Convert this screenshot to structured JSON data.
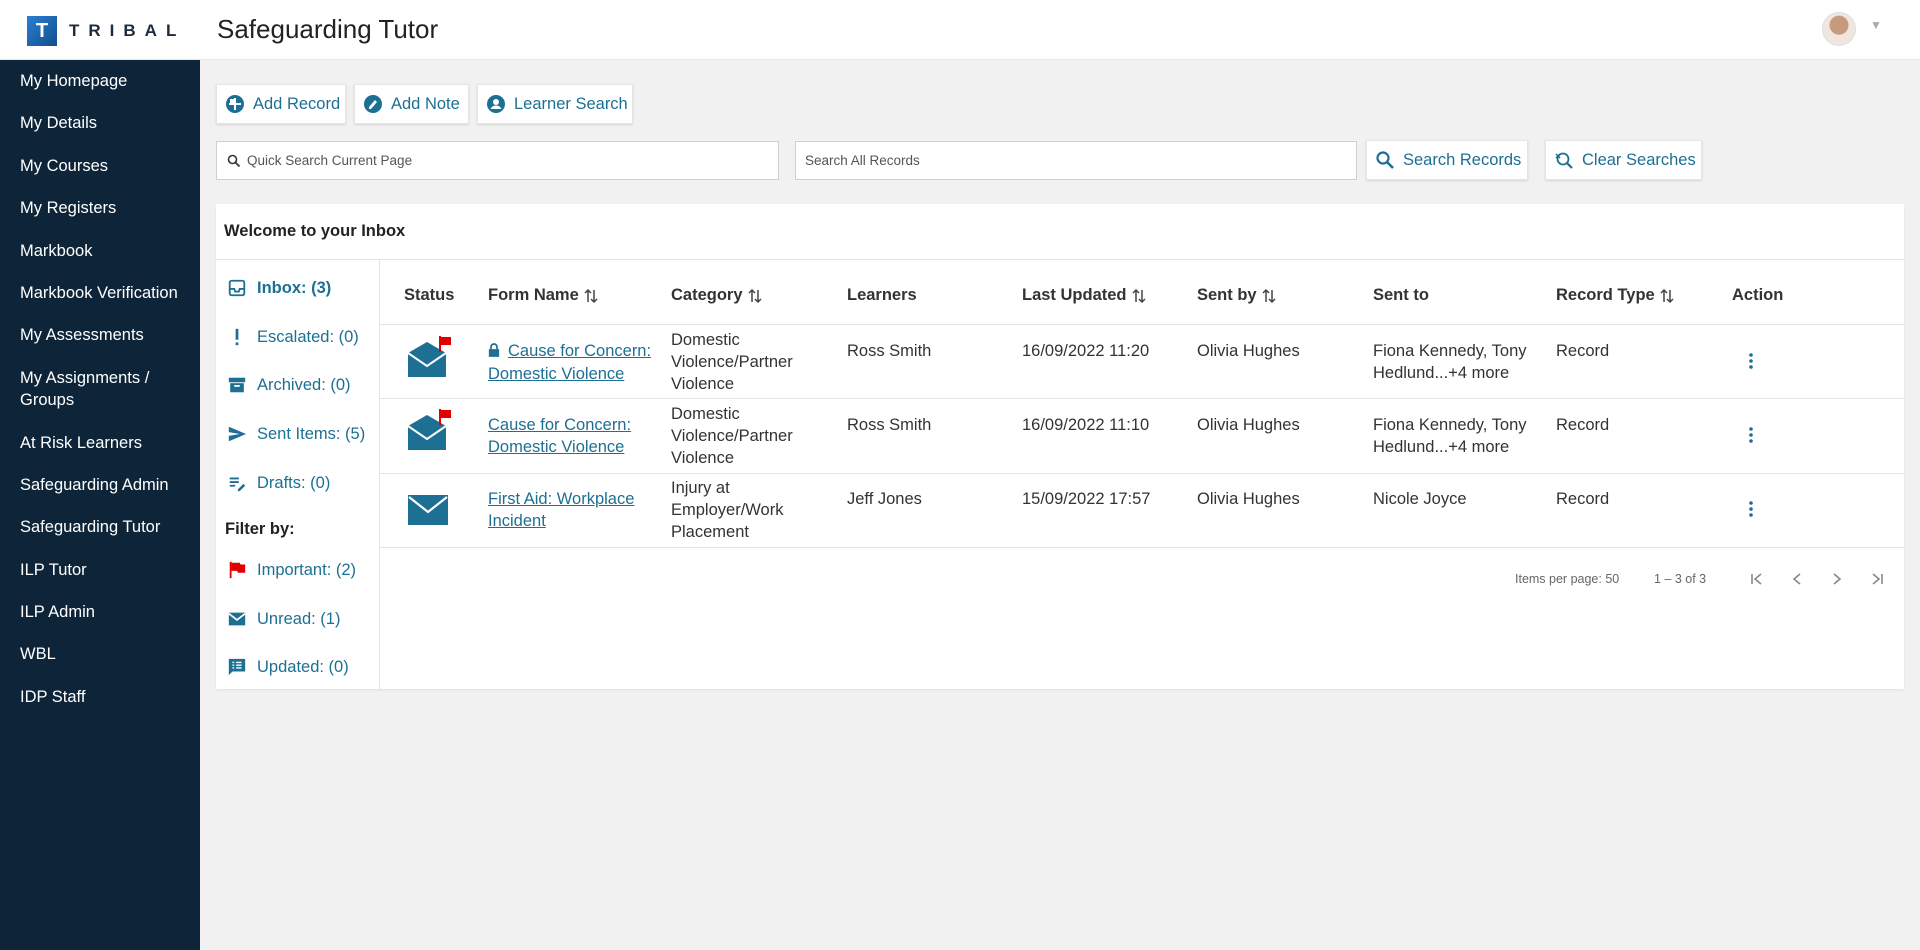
{
  "header": {
    "logo_letter": "T",
    "logo_text": "TRIBAL",
    "title": "Safeguarding Tutor"
  },
  "sidebar": {
    "items": [
      {
        "label": "My Homepage"
      },
      {
        "label": "My Details"
      },
      {
        "label": "My Courses"
      },
      {
        "label": "My Registers"
      },
      {
        "label": "Markbook"
      },
      {
        "label": "Markbook Verification"
      },
      {
        "label": "My Assessments"
      },
      {
        "label": "My Assignments / Groups"
      },
      {
        "label": "At Risk Learners"
      },
      {
        "label": "Safeguarding Admin"
      },
      {
        "label": "Safeguarding Tutor"
      },
      {
        "label": "ILP Tutor"
      },
      {
        "label": "ILP Admin"
      },
      {
        "label": "WBL"
      },
      {
        "label": "IDP Staff"
      }
    ]
  },
  "toolbar": {
    "add_record": "Add Record",
    "add_note": "Add Note",
    "learner_search": "Learner Search"
  },
  "search": {
    "quick_placeholder": "Quick Search Current Page",
    "all_placeholder": "Search All Records",
    "search_button": "Search Records",
    "clear_button": "Clear Searches"
  },
  "inbox": {
    "title": "Welcome to your Inbox",
    "folders": [
      {
        "label": "Inbox: (3)"
      },
      {
        "label": "Escalated: (0)"
      },
      {
        "label": "Archived: (0)"
      },
      {
        "label": "Sent Items: (5)"
      },
      {
        "label": "Drafts: (0)"
      }
    ],
    "filter_label": "Filter by:",
    "filters": [
      {
        "label": "Important: (2)"
      },
      {
        "label": "Unread: (1)"
      },
      {
        "label": "Updated: (0)"
      }
    ],
    "columns": [
      "Status",
      "Form Name",
      "Category",
      "Learners",
      "Last Updated",
      "Sent by",
      "Sent to",
      "Record Type",
      "Action"
    ],
    "rows": [
      {
        "form_name": "Cause for Concern: Domestic Violence",
        "category": "Domestic Violence/Partner Violence",
        "learners": "Ross Smith",
        "last_updated": "16/09/2022 11:20",
        "sent_by": "Olivia Hughes",
        "sent_to": "Fiona Kennedy, Tony Hedlund...+4 more",
        "record_type": "Record"
      },
      {
        "form_name": "Cause for Concern: Domestic Violence",
        "category": "Domestic Violence/Partner Violence",
        "learners": "Ross Smith",
        "last_updated": "16/09/2022 11:10",
        "sent_by": "Olivia Hughes",
        "sent_to": "Fiona Kennedy, Tony Hedlund...+4 more",
        "record_type": "Record"
      },
      {
        "form_name": "First Aid: Workplace Incident",
        "category": "Injury at Employer/Work Placement",
        "learners": "Jeff Jones",
        "last_updated": "15/09/2022 17:57",
        "sent_by": "Olivia Hughes",
        "sent_to": "Nicole Joyce",
        "record_type": "Record"
      }
    ],
    "paginator": {
      "items_per_page": "Items per page: 50",
      "range": "1 – 3 of 3"
    }
  },
  "colors": {
    "sidebar_bg": "#0e2439",
    "accent": "#1d6f93",
    "flag": "#e00000"
  }
}
